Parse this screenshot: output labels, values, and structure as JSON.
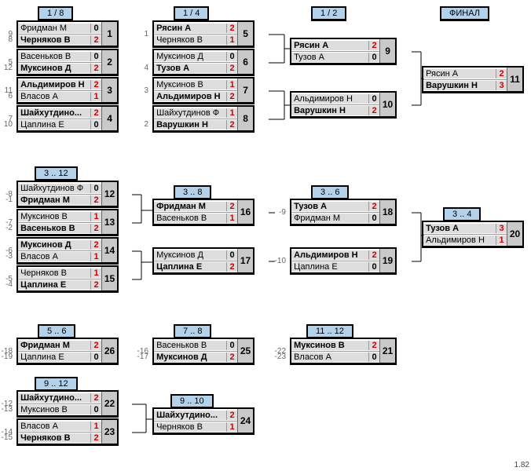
{
  "headers": {
    "c1_top": "1 / 8",
    "c2_top": "1 / 4",
    "c3_top": "1 / 2",
    "c4_top": "ФИНАЛ",
    "c1_312": "3 .. 12",
    "c2_38": "3 .. 8",
    "c3_36": "3 .. 6",
    "c4_34": "3 .. 4",
    "c1_56": "5 .. 6",
    "c2_78": "7 .. 8",
    "c3_1112": "11 .. 12",
    "c1_912": "9 .. 12",
    "c2_910": "9 .. 10"
  },
  "matches": {
    "m1": {
      "s1": "9",
      "n1": "Фридман М",
      "sc1": "0",
      "s2": "8",
      "n2": "Черняков В",
      "sc2": "2",
      "num": "1",
      "w": 2
    },
    "m2": {
      "s1": "5",
      "n1": "Васеньков В",
      "sc1": "0",
      "s2": "12",
      "n2": "Муксинов Д",
      "sc2": "2",
      "num": "2",
      "w": 2
    },
    "m3": {
      "s1": "11",
      "n1": "Альдимиров Н",
      "sc1": "2",
      "s2": "6",
      "n2": "Власов А",
      "sc2": "1",
      "num": "3",
      "w": 1
    },
    "m4": {
      "s1": "7",
      "n1": "Шайхутдино...",
      "sc1": "2",
      "s2": "10",
      "n2": "Цаплина Е",
      "sc2": "0",
      "num": "4",
      "w": 1
    },
    "m5": {
      "s1": "1",
      "n1": "Рясин А",
      "sc1": "2",
      "s2": "",
      "n2": "Черняков В",
      "sc2": "1",
      "num": "5",
      "w": 1
    },
    "m6": {
      "s1": "",
      "n1": "Муксинов Д",
      "sc1": "0",
      "s2": "4",
      "n2": "Тузов А",
      "sc2": "2",
      "num": "6",
      "w": 2
    },
    "m7": {
      "s1": "3",
      "n1": "Муксинов В",
      "sc1": "1",
      "s2": "",
      "n2": "Альдимиров Н",
      "sc2": "2",
      "num": "7",
      "w": 2
    },
    "m8": {
      "s1": "",
      "n1": "Шайхутдинов Ф",
      "sc1": "1",
      "s2": "2",
      "n2": "Варушкин Н",
      "sc2": "2",
      "num": "8",
      "w": 2
    },
    "m9": {
      "s1": "",
      "n1": "Рясин А",
      "sc1": "2",
      "s2": "",
      "n2": "Тузов А",
      "sc2": "0",
      "num": "9",
      "w": 1
    },
    "m10": {
      "s1": "",
      "n1": "Альдимиров Н",
      "sc1": "0",
      "s2": "",
      "n2": "Варушкин Н",
      "sc2": "2",
      "num": "10",
      "w": 2
    },
    "m11": {
      "s1": "",
      "n1": "Рясин А",
      "sc1": "2",
      "s2": "",
      "n2": "Варушкин Н",
      "sc2": "3",
      "num": "11",
      "w": 2
    },
    "m12": {
      "s1": "-8",
      "n1": "Шайхутдинов Ф",
      "sc1": "0",
      "s2": "-1",
      "n2": "Фридман М",
      "sc2": "2",
      "num": "12",
      "w": 2
    },
    "m13": {
      "s1": "-7",
      "n1": "Муксинов В",
      "sc1": "1",
      "s2": "-2",
      "n2": "Васеньков В",
      "sc2": "2",
      "num": "13",
      "w": 2
    },
    "m14": {
      "s1": "-6",
      "n1": "Муксинов Д",
      "sc1": "2",
      "s2": "-3",
      "n2": "Власов А",
      "sc2": "1",
      "num": "14",
      "w": 1
    },
    "m15": {
      "s1": "-5",
      "n1": "Черняков В",
      "sc1": "1",
      "s2": "-4",
      "n2": "Цаплина Е",
      "sc2": "2",
      "num": "15",
      "w": 2
    },
    "m16": {
      "s1": "",
      "n1": "Фридман М",
      "sc1": "2",
      "s2": "",
      "n2": "Васеньков В",
      "sc2": "1",
      "num": "16",
      "w": 1
    },
    "m17": {
      "s1": "",
      "n1": "Муксинов Д",
      "sc1": "0",
      "s2": "",
      "n2": "Цаплина Е",
      "sc2": "2",
      "num": "17",
      "w": 2
    },
    "m18": {
      "s1": "-9",
      "n1": "Тузов А",
      "sc1": "2",
      "s2": "",
      "n2": "Фридман М",
      "sc2": "0",
      "num": "18",
      "w": 1
    },
    "m19": {
      "s1": "-10",
      "n1": "Альдимиров Н",
      "sc1": "2",
      "s2": "",
      "n2": "Цаплина Е",
      "sc2": "0",
      "num": "19",
      "w": 1
    },
    "m20": {
      "s1": "",
      "n1": "Тузов А",
      "sc1": "3",
      "s2": "",
      "n2": "Альдимиров Н",
      "sc2": "1",
      "num": "20",
      "w": 1
    },
    "m26": {
      "s1": "-18",
      "n1": "Фридман М",
      "sc1": "2",
      "s2": "-19",
      "n2": "Цаплина Е",
      "sc2": "0",
      "num": "26",
      "w": 1
    },
    "m25": {
      "s1": "-16",
      "n1": "Васеньков В",
      "sc1": "0",
      "s2": "-17",
      "n2": "Муксинов Д",
      "sc2": "2",
      "num": "25",
      "w": 2
    },
    "m21": {
      "s1": "-22",
      "n1": "Муксинов В",
      "sc1": "2",
      "s2": "-23",
      "n2": "Власов А",
      "sc2": "0",
      "num": "21",
      "w": 1
    },
    "m22": {
      "s1": "-12",
      "n1": "Шайхутдино...",
      "sc1": "2",
      "s2": "-13",
      "n2": "Муксинов В",
      "sc2": "0",
      "num": "22",
      "w": 1
    },
    "m23": {
      "s1": "-14",
      "n1": "Власов А",
      "sc1": "1",
      "s2": "-15",
      "n2": "Черняков В",
      "sc2": "2",
      "num": "23",
      "w": 2
    },
    "m24": {
      "s1": "",
      "n1": "Шайхутдино...",
      "sc1": "2",
      "s2": "",
      "n2": "Черняков В",
      "sc2": "1",
      "num": "24",
      "w": 1
    }
  },
  "version": "1.82",
  "chart_data": {
    "type": "table",
    "title": "Tournament bracket (single-elimination with consolation brackets)",
    "rounds": [
      {
        "label": "1 / 8",
        "matches": [
          1,
          2,
          3,
          4
        ]
      },
      {
        "label": "1 / 4",
        "matches": [
          5,
          6,
          7,
          8
        ]
      },
      {
        "label": "1 / 2",
        "matches": [
          9,
          10
        ]
      },
      {
        "label": "ФИНАЛ",
        "matches": [
          11
        ]
      },
      {
        "label": "3 .. 12",
        "matches": [
          12,
          13,
          14,
          15
        ]
      },
      {
        "label": "3 .. 8",
        "matches": [
          16,
          17
        ]
      },
      {
        "label": "3 .. 6",
        "matches": [
          18,
          19
        ]
      },
      {
        "label": "3 .. 4",
        "matches": [
          20
        ]
      },
      {
        "label": "5 .. 6",
        "matches": [
          26
        ]
      },
      {
        "label": "7 .. 8",
        "matches": [
          25
        ]
      },
      {
        "label": "11 .. 12",
        "matches": [
          21
        ]
      },
      {
        "label": "9 .. 12",
        "matches": [
          22,
          23
        ]
      },
      {
        "label": "9 .. 10",
        "matches": [
          24
        ]
      }
    ],
    "results": [
      {
        "m": 1,
        "p": [
          "Фридман М",
          "Черняков В"
        ],
        "s": [
          0,
          2
        ]
      },
      {
        "m": 2,
        "p": [
          "Васеньков В",
          "Муксинов Д"
        ],
        "s": [
          0,
          2
        ]
      },
      {
        "m": 3,
        "p": [
          "Альдимиров Н",
          "Власов А"
        ],
        "s": [
          2,
          1
        ]
      },
      {
        "m": 4,
        "p": [
          "Шайхутдинов Ф",
          "Цаплина Е"
        ],
        "s": [
          2,
          0
        ]
      },
      {
        "m": 5,
        "p": [
          "Рясин А",
          "Черняков В"
        ],
        "s": [
          2,
          1
        ]
      },
      {
        "m": 6,
        "p": [
          "Муксинов Д",
          "Тузов А"
        ],
        "s": [
          0,
          2
        ]
      },
      {
        "m": 7,
        "p": [
          "Муксинов В",
          "Альдимиров Н"
        ],
        "s": [
          1,
          2
        ]
      },
      {
        "m": 8,
        "p": [
          "Шайхутдинов Ф",
          "Варушкин Н"
        ],
        "s": [
          1,
          2
        ]
      },
      {
        "m": 9,
        "p": [
          "Рясин А",
          "Тузов А"
        ],
        "s": [
          2,
          0
        ]
      },
      {
        "m": 10,
        "p": [
          "Альдимиров Н",
          "Варушкин Н"
        ],
        "s": [
          0,
          2
        ]
      },
      {
        "m": 11,
        "p": [
          "Рясин А",
          "Варушкин Н"
        ],
        "s": [
          2,
          3
        ]
      },
      {
        "m": 12,
        "p": [
          "Шайхутдинов Ф",
          "Фридман М"
        ],
        "s": [
          0,
          2
        ]
      },
      {
        "m": 13,
        "p": [
          "Муксинов В",
          "Васеньков В"
        ],
        "s": [
          1,
          2
        ]
      },
      {
        "m": 14,
        "p": [
          "Муксинов Д",
          "Власов А"
        ],
        "s": [
          2,
          1
        ]
      },
      {
        "m": 15,
        "p": [
          "Черняков В",
          "Цаплина Е"
        ],
        "s": [
          1,
          2
        ]
      },
      {
        "m": 16,
        "p": [
          "Фридман М",
          "Васеньков В"
        ],
        "s": [
          2,
          1
        ]
      },
      {
        "m": 17,
        "p": [
          "Муксинов Д",
          "Цаплина Е"
        ],
        "s": [
          0,
          2
        ]
      },
      {
        "m": 18,
        "p": [
          "Тузов А",
          "Фридман М"
        ],
        "s": [
          2,
          0
        ]
      },
      {
        "m": 19,
        "p": [
          "Альдимиров Н",
          "Цаплина Е"
        ],
        "s": [
          2,
          0
        ]
      },
      {
        "m": 20,
        "p": [
          "Тузов А",
          "Альдимиров Н"
        ],
        "s": [
          3,
          1
        ]
      },
      {
        "m": 21,
        "p": [
          "Муксинов В",
          "Власов А"
        ],
        "s": [
          2,
          0
        ]
      },
      {
        "m": 22,
        "p": [
          "Шайхутдинов Ф",
          "Муксинов В"
        ],
        "s": [
          2,
          0
        ]
      },
      {
        "m": 23,
        "p": [
          "Власов А",
          "Черняков В"
        ],
        "s": [
          1,
          2
        ]
      },
      {
        "m": 24,
        "p": [
          "Шайхутдинов Ф",
          "Черняков В"
        ],
        "s": [
          2,
          1
        ]
      },
      {
        "m": 25,
        "p": [
          "Васеньков В",
          "Муксинов Д"
        ],
        "s": [
          0,
          2
        ]
      },
      {
        "m": 26,
        "p": [
          "Фридман М",
          "Цаплина Е"
        ],
        "s": [
          2,
          0
        ]
      }
    ]
  }
}
